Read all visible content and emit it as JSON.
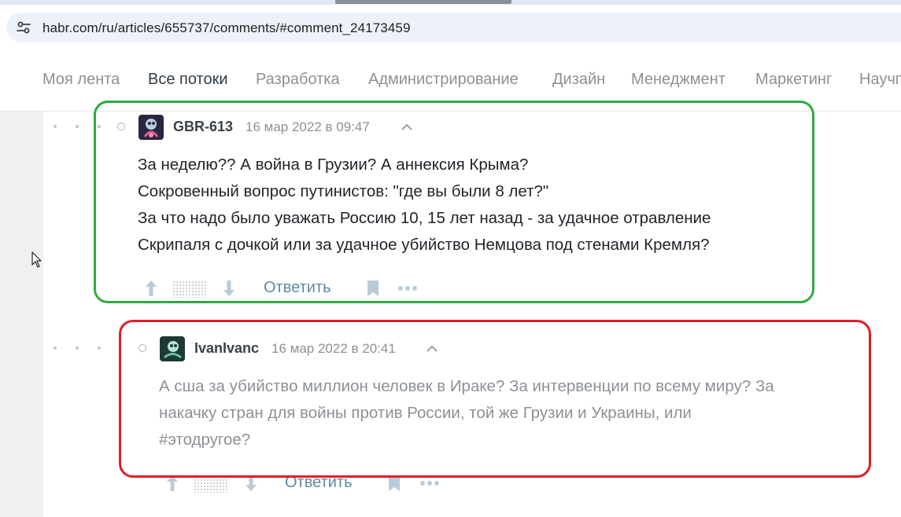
{
  "browser": {
    "url": "habr.com/ru/articles/655737/comments/#comment_24173459"
  },
  "nav": {
    "items": [
      "Моя лента",
      "Все потоки",
      "Разработка",
      "Администрирование",
      "Дизайн",
      "Менеджмент",
      "Маркетинг",
      "Научп"
    ],
    "active_index": 1
  },
  "comments": [
    {
      "username": "GBR-613",
      "date": "16 мар 2022 в 09:47",
      "lines": [
        "За неделю?? А война в Грузии? А аннексия Крыма?",
        "Сокровенный вопрос путинистов: \"где вы были 8 лет?\"",
        "За что надо было уважать Россию 10, 15 лет назад - за удачное отравление",
        "Скрипаля с дочкой или за удачное убийство Немцова под стенами Кремля?"
      ],
      "reply_label": "Ответить",
      "highlight_color": "#2eaa3f"
    },
    {
      "username": "IvanIvanc",
      "date": "16 мар 2022 в 20:41",
      "lines": [
        "А сша за убийство миллион человек в Ираке? За интервенции по всему миру? За",
        "накачку стран для войны против России, той же Грузии и Украины, или",
        "#этодругое?"
      ],
      "reply_label": "Ответить",
      "highlight_color": "#e21d26"
    }
  ],
  "icons": {
    "site_info": "tune-icon",
    "upvote": "arrow-up-icon",
    "downvote": "arrow-down-icon",
    "bookmark": "bookmark-icon",
    "more": "more-dots-icon",
    "collapse": "chevron-up-icon",
    "cursor": "mouse-pointer-icon"
  }
}
